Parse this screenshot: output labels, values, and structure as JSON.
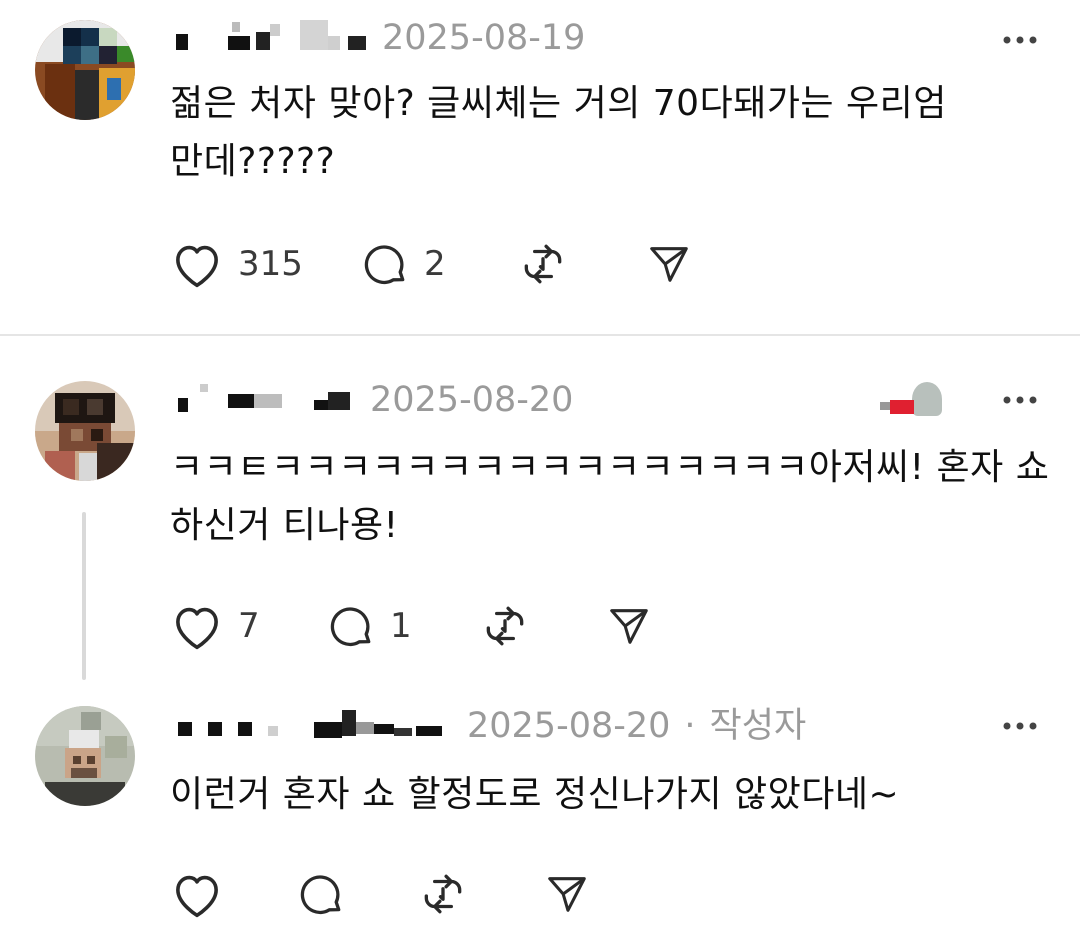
{
  "posts": [
    {
      "date": "2025-08-19",
      "text_line1": "젊은 처자 맞아? 글씨체는 거의 70다돼가는 우리엄",
      "text_line2": "만데?????",
      "likes": "315",
      "replies": "2"
    },
    {
      "date": "2025-08-20",
      "text_line1": "ㅋㅋㅌㅋㅋㅋㅋㅋㅋㅋㅋㅋㅋㅋㅋㅋㅋㅋㅋ아저씨! 혼자 쇼",
      "text_line2": "하신거 티나용!",
      "likes": "7",
      "replies": "1"
    },
    {
      "date": "2025-08-20",
      "separator": "·",
      "author_tag": "작성자",
      "text_line1": "이런거 혼자 쇼 할정도로 정신나가지 않았다네~",
      "likes": "",
      "replies": ""
    }
  ],
  "icons": {
    "like": "heart-icon",
    "reply": "comment-icon",
    "repost": "repost-icon",
    "share": "send-icon",
    "more": "more-icon"
  },
  "colors": {
    "text": "#101010",
    "meta": "#9a9a9a",
    "icon": "#2a2a2a",
    "divider": "#e5e5e5"
  }
}
